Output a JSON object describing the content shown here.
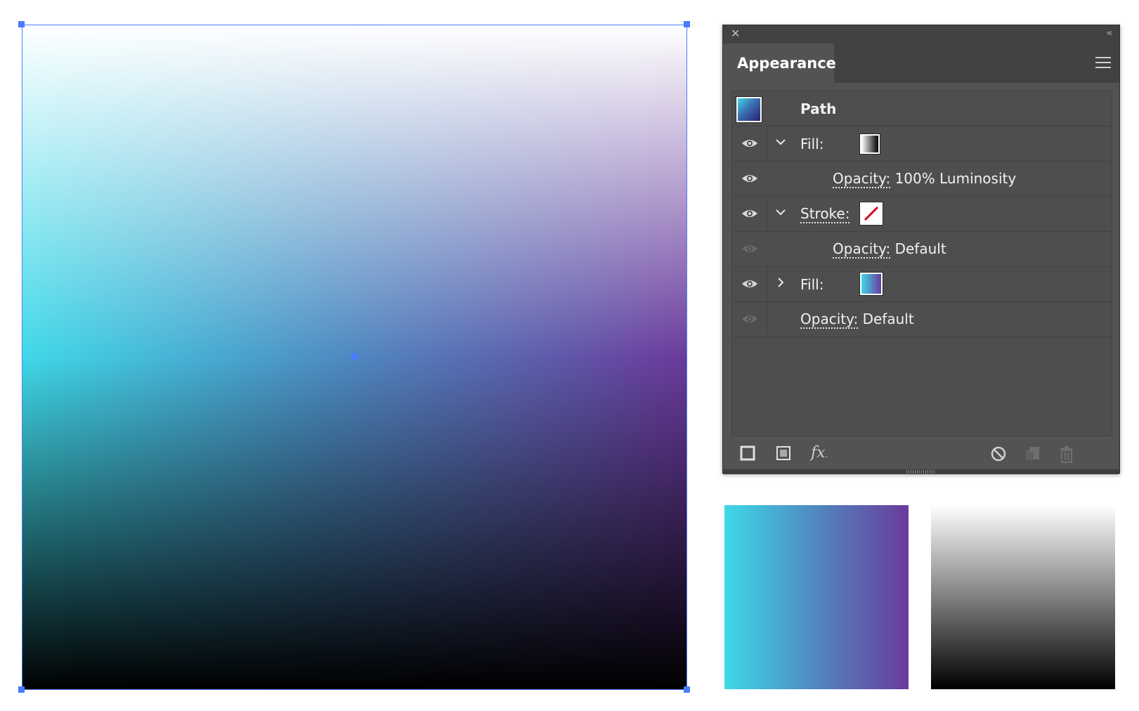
{
  "window": {
    "close_glyph": "✕",
    "collapse_glyph": "‹‹"
  },
  "panel": {
    "title": "Appearance",
    "object_label": "Path",
    "rows": [
      {
        "kind": "fill",
        "label": "Fill:",
        "expanded": true,
        "swatch": "white-to-black gradient",
        "visible": true
      },
      {
        "kind": "opacity",
        "label": "Opacity:",
        "value": "100% Luminosity",
        "visible": true
      },
      {
        "kind": "stroke",
        "label": "Stroke:",
        "expanded": true,
        "swatch": "none",
        "visible": true
      },
      {
        "kind": "opacity",
        "label": "Opacity:",
        "value": "Default",
        "visible": false
      },
      {
        "kind": "fill",
        "label": "Fill:",
        "expanded": false,
        "swatch": "cyan-to-purple gradient",
        "visible": true
      },
      {
        "kind": "opacity",
        "label": "Opacity:",
        "value": "Default",
        "visible": false
      }
    ],
    "footer": {
      "fx_label": "fx"
    }
  },
  "icons": [
    "close-icon",
    "collapse-icon",
    "panel-menu-icon",
    "eye-icon",
    "chevron-down-icon",
    "chevron-right-icon",
    "add-stroke-icon",
    "add-fill-icon",
    "fx-icon",
    "clear-appearance-icon",
    "duplicate-item-icon",
    "delete-item-icon"
  ],
  "colors": {
    "selection": "#4a7cff",
    "gradient_start": "#3fd9e8",
    "gradient_mid": "#4d8fc4",
    "gradient_end": "#6a3a9c",
    "panel_bg": "#535353",
    "stroke_none_red": "#d0021b"
  }
}
